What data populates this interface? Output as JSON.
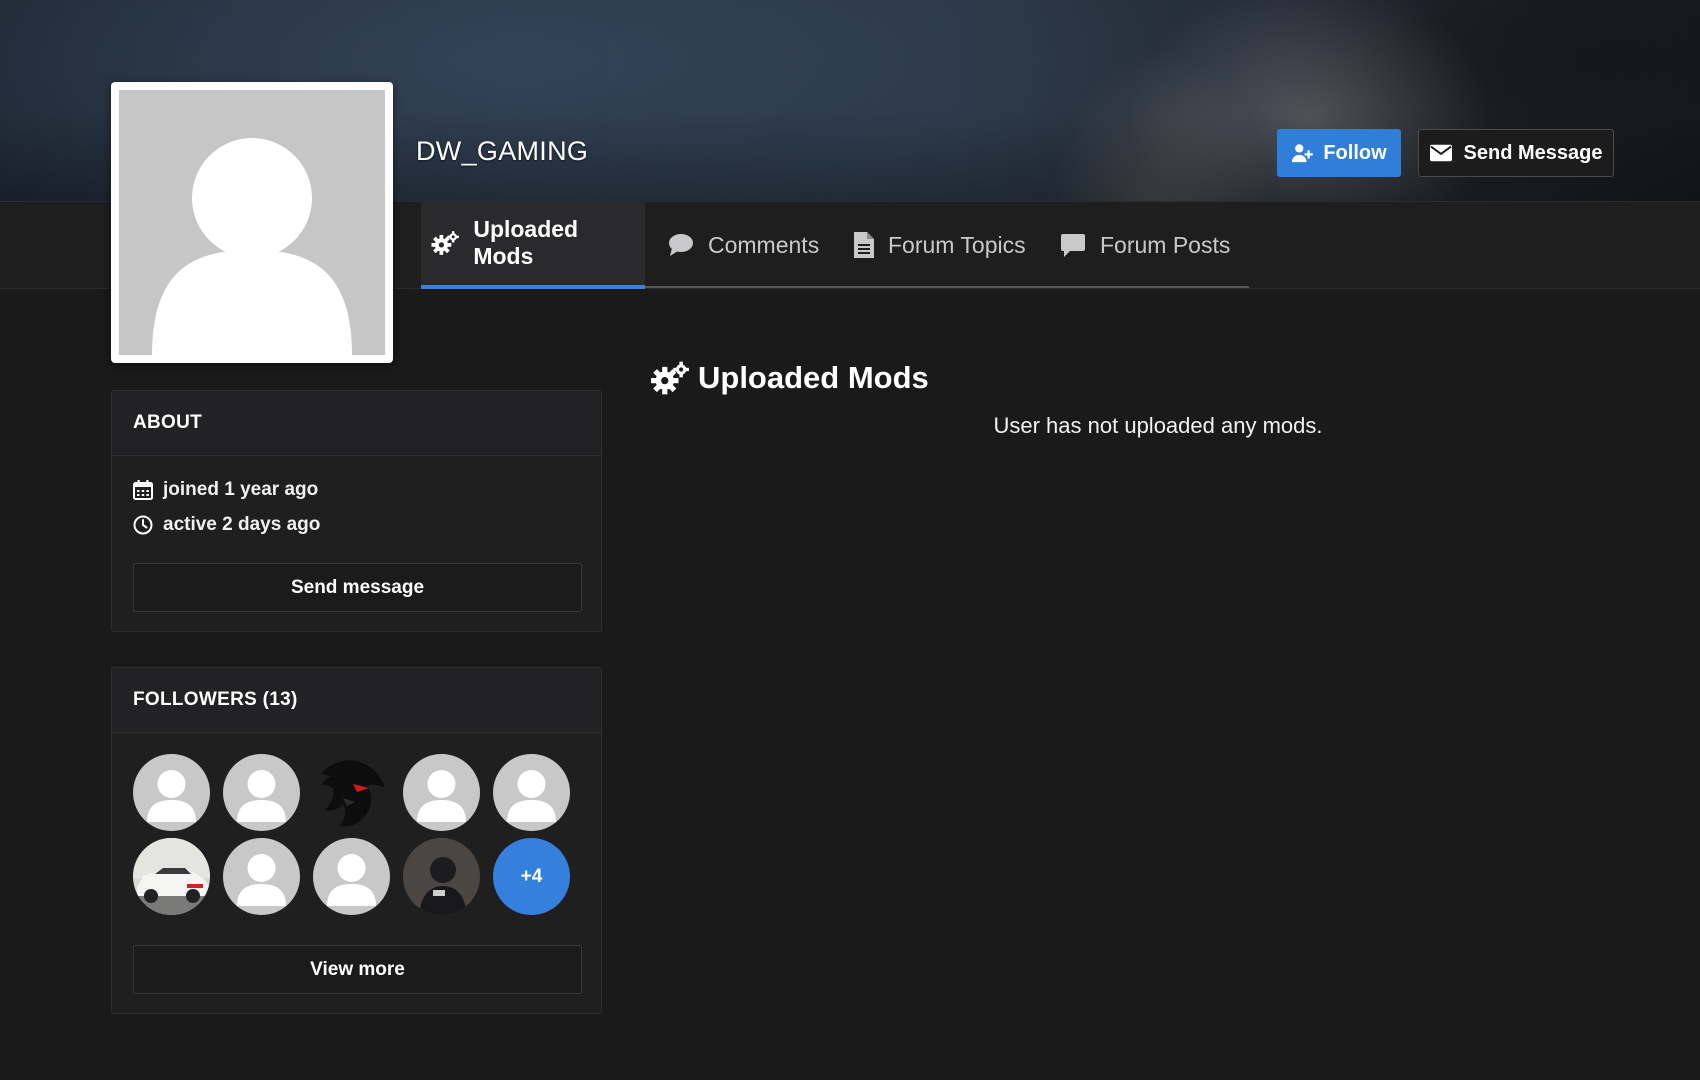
{
  "profile": {
    "username": "DW_GAMING"
  },
  "header_actions": {
    "follow_label": "Follow",
    "send_message_label": "Send Message"
  },
  "tabs": [
    {
      "label": "Uploaded Mods",
      "icon": "gears-icon",
      "active": true
    },
    {
      "label": "Comments",
      "icon": "comment-icon",
      "active": false
    },
    {
      "label": "Forum Topics",
      "icon": "document-icon",
      "active": false
    },
    {
      "label": "Forum Posts",
      "icon": "message-icon",
      "active": false
    }
  ],
  "about": {
    "title": "ABOUT",
    "joined": "joined 1 year ago",
    "active": "active 2 days ago",
    "send_message_label": "Send message"
  },
  "followers": {
    "title": "FOLLOWERS (13)",
    "items": [
      {
        "type": "default"
      },
      {
        "type": "default"
      },
      {
        "type": "logo"
      },
      {
        "type": "default"
      },
      {
        "type": "default"
      },
      {
        "type": "car-photo"
      },
      {
        "type": "default"
      },
      {
        "type": "default"
      },
      {
        "type": "photo"
      },
      {
        "type": "more",
        "label": "+4"
      }
    ],
    "view_more_label": "View more"
  },
  "main": {
    "section_title": "Uploaded Mods",
    "empty_message": "User has not uploaded any mods."
  },
  "colors": {
    "accent": "#2f7fd9",
    "background": "#1a1a1b",
    "panel": "#1f1f20"
  }
}
